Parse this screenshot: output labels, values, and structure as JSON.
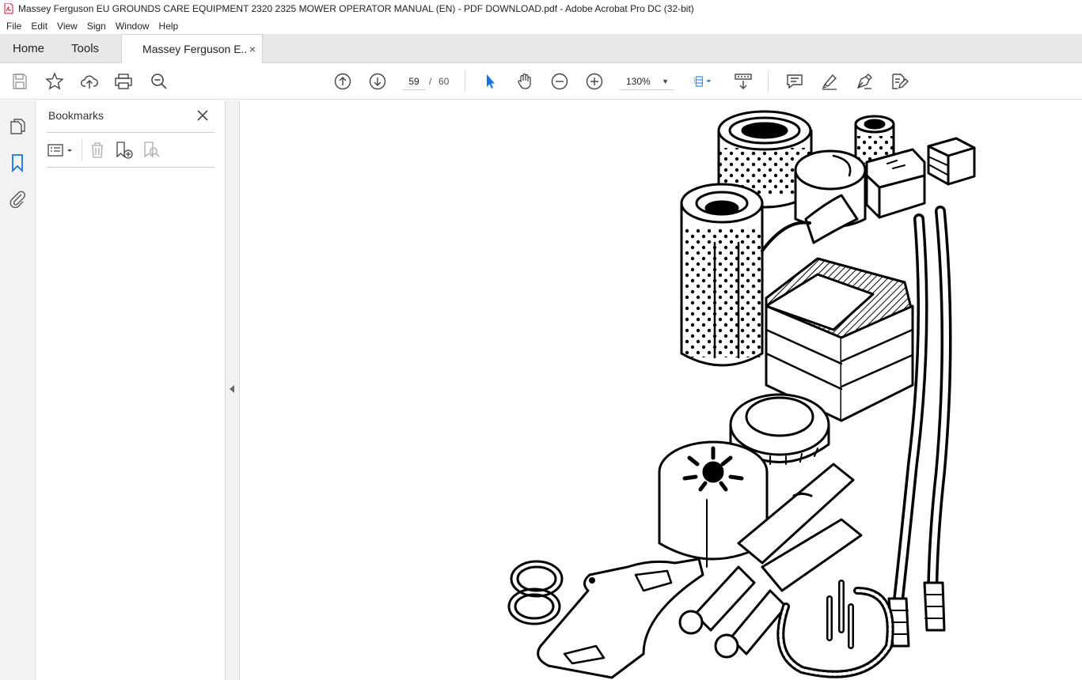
{
  "window": {
    "title": "Massey Ferguson EU GROUNDS CARE EQUIPMENT 2320  2325 MOWER OPERATOR MANUAL (EN) - PDF DOWNLOAD.pdf - Adobe Acrobat Pro DC (32-bit)"
  },
  "menu": [
    "File",
    "Edit",
    "View",
    "Sign",
    "Window",
    "Help"
  ],
  "tabs": {
    "home": "Home",
    "tools": "Tools",
    "document": "Massey Ferguson E...",
    "close": "×"
  },
  "toolbar": {
    "current_page": "59",
    "page_separator": "/",
    "total_pages": "60",
    "zoom": "130%",
    "zoom_caret": "▼"
  },
  "bookmarks": {
    "title": "Bookmarks"
  },
  "colors": {
    "accent": "#1473e6",
    "title_icon": "#c8102e"
  }
}
